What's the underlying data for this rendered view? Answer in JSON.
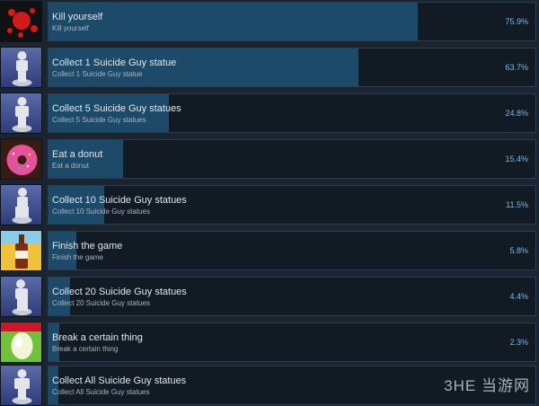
{
  "achievements": [
    {
      "title": "Kill yourself",
      "desc": "Kill yourself",
      "percent": "75.9%",
      "fill_percent": 75.9,
      "icon": "blood-splatter-icon"
    },
    {
      "title": "Collect 1 Suicide Guy statue",
      "desc": "Collect 1 Suicide Guy statue",
      "percent": "63.7%",
      "fill_percent": 63.7,
      "icon": "statue-icon"
    },
    {
      "title": "Collect 5 Suicide Guy statues",
      "desc": "Collect 5 Suicide Guy statues",
      "percent": "24.8%",
      "fill_percent": 24.8,
      "icon": "statue-icon"
    },
    {
      "title": "Eat a donut",
      "desc": "Eat a donut",
      "percent": "15.4%",
      "fill_percent": 15.4,
      "icon": "donut-icon"
    },
    {
      "title": "Collect 10 Suicide Guy statues",
      "desc": "Collect 10 Suicide Guy statues",
      "percent": "11.5%",
      "fill_percent": 11.5,
      "icon": "statue-icon"
    },
    {
      "title": "Finish the game",
      "desc": "Finish the game",
      "percent": "5.8%",
      "fill_percent": 5.8,
      "icon": "bottle-icon"
    },
    {
      "title": "Collect 20 Suicide Guy statues",
      "desc": "Collect 20 Suicide Guy statues",
      "percent": "4.4%",
      "fill_percent": 4.4,
      "icon": "statue-icon"
    },
    {
      "title": "Break a certain thing",
      "desc": "Break a certain thing",
      "percent": "2.3%",
      "fill_percent": 2.3,
      "icon": "egg-icon"
    },
    {
      "title": "Collect All Suicide Guy statues",
      "desc": "Collect All Suicide Guy statues",
      "percent": "",
      "fill_percent": 2.0,
      "icon": "statue-icon"
    }
  ],
  "watermark": "3HE 当游网"
}
